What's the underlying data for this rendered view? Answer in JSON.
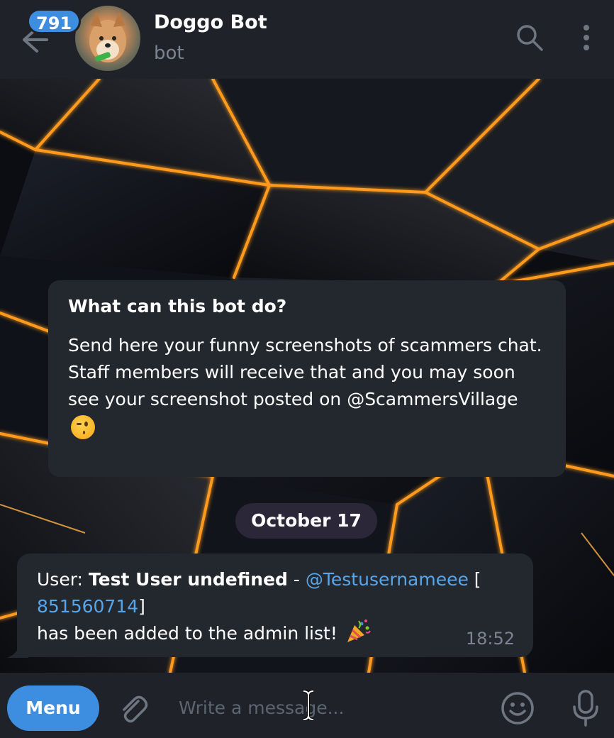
{
  "header": {
    "unread_count": "791",
    "title": "Doggo Bot",
    "subtitle": "bot",
    "icons": [
      "back-arrow-icon",
      "search-icon",
      "more-vertical-icon"
    ]
  },
  "bot_info": {
    "title": "What can this bot do?",
    "line1": "Send here your funny screenshots of scammers chat.",
    "line2": "Staff members will receive that and you may soon see your screenshot posted on @ScammersVillage",
    "emoji": "winking-face-emoji"
  },
  "date_chip": "October 17",
  "message": {
    "prefix": "User: ",
    "user_name": "Test User undefined",
    "separator": " - ",
    "username": "@Testusernameee",
    "open_bracket": " [",
    "user_id": "851560714",
    "close_bracket": "]",
    "line2": "has been added to the admin list! ",
    "emoji": "party-popper-emoji",
    "time": "18:52"
  },
  "composer": {
    "menu_label": "Menu",
    "placeholder": "Write a message...",
    "icons": [
      "attach-icon",
      "emoji-icon",
      "microphone-icon"
    ]
  },
  "colors": {
    "accent": "#3d8ee0",
    "link": "#58a6ea",
    "header_bg": "#1f2329",
    "bubble_bg": "#23272e",
    "glow": "#ff9a1f"
  }
}
